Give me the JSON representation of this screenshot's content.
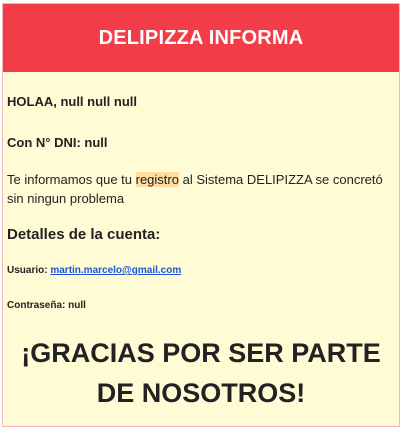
{
  "header": {
    "title": "DELIPIZZA INFORMA"
  },
  "greeting": "HOLAA, null null null",
  "dni": "Con N° DNI: null",
  "message": {
    "before": "Te informamos que tu ",
    "highlight": "registro",
    "after": " al Sistema DELIPIZZA se concretó sin ningun problema"
  },
  "details": {
    "title": "Detalles de la cuenta:",
    "user_label": "Usuario:",
    "user_email": "martin.marcelo@gmail.com",
    "password_label": "Contraseña:",
    "password_value": "null"
  },
  "thanks": "¡GRACIAS POR SER PARTE DE NOSOTROS!",
  "colors": {
    "header_bg": "#f23c48",
    "body_bg": "#fffbd5",
    "link": "#1d55d8",
    "highlight": "#ffdca0"
  }
}
